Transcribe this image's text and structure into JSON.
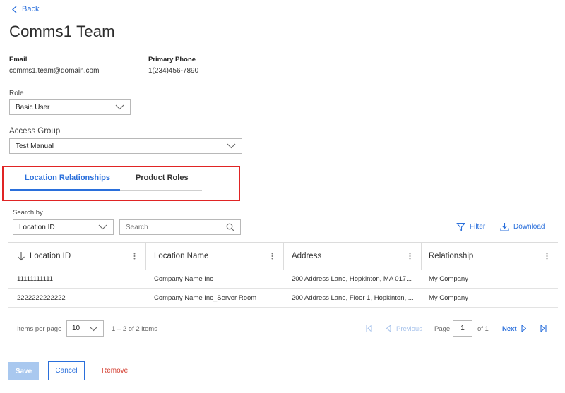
{
  "nav": {
    "back_label": "Back"
  },
  "page": {
    "title": "Comms1 Team"
  },
  "contact": {
    "email_label": "Email",
    "email_value": "comms1.team@domain.com",
    "phone_label": "Primary Phone",
    "phone_value": "1(234)456-7890"
  },
  "role": {
    "label": "Role",
    "value": "Basic User"
  },
  "access_group": {
    "label": "Access Group",
    "value": "Test Manual"
  },
  "tabs": [
    {
      "label": "Location Relationships",
      "active": true
    },
    {
      "label": "Product Roles",
      "active": false
    }
  ],
  "search": {
    "by_label": "Search by",
    "field_value": "Location ID",
    "placeholder": "Search"
  },
  "toolbar": {
    "filter_label": "Filter",
    "download_label": "Download"
  },
  "table": {
    "columns": [
      "Location ID",
      "Location Name",
      "Address",
      "Relationship"
    ],
    "rows": [
      [
        "11111111111",
        "Company Name Inc",
        "200 Address Lane, Hopkinton, MA 017...",
        "My Company"
      ],
      [
        "2222222222222",
        "Company Name Inc_Server Room",
        "200 Address Lane, Floor 1, Hopkinton, ...",
        "My Company"
      ]
    ]
  },
  "pagination": {
    "items_per_page_label": "Items per page",
    "items_per_page_value": "10",
    "range_text": "1 – 2 of 2 items",
    "previous_label": "Previous",
    "page_label": "Page",
    "page_value": "1",
    "of_text": "of 1",
    "next_label": "Next"
  },
  "actions": {
    "save_label": "Save",
    "cancel_label": "Cancel",
    "remove_label": "Remove"
  },
  "colors": {
    "accent": "#2a6fdb",
    "highlight_box": "#e02424",
    "remove": "#d33a2c"
  }
}
